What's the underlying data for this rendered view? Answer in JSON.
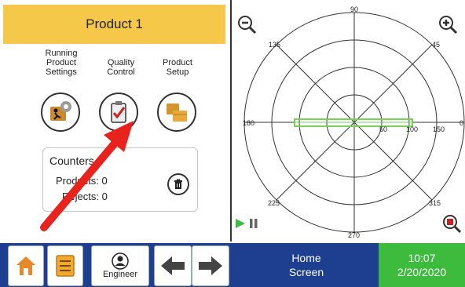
{
  "header": {
    "title": "Product 1"
  },
  "menu": {
    "running": {
      "label_lines": [
        "Running",
        "Product",
        "Settings"
      ]
    },
    "quality": {
      "label_lines": [
        "Quality",
        "Control"
      ]
    },
    "setup": {
      "label_lines": [
        "Product",
        "Setup"
      ]
    }
  },
  "counters": {
    "title": "Counters",
    "products_label": "Products:",
    "products_value": "0",
    "rejects_label": "Rejects:",
    "rejects_value": "0"
  },
  "polar": {
    "angle_labels": {
      "a90": "90",
      "a45": "45",
      "a0": "0",
      "a315": "315",
      "a270": "270",
      "a225": "225",
      "a180": "180",
      "a135": "135"
    },
    "radial_labels": {
      "r50": "50",
      "r100": "100",
      "r150": "150"
    }
  },
  "bottom": {
    "engineer_label": "Engineer",
    "home_screen_lines": [
      "Home",
      "Screen"
    ],
    "time": "10:07",
    "date": "2/20/2020"
  },
  "colors": {
    "header_bg": "#f5c84a",
    "bottom_bar": "#1e3f8f",
    "clock_bg": "#3dbb3d",
    "arrow": "#e8231d",
    "polar_trace": "#7ad15a"
  }
}
